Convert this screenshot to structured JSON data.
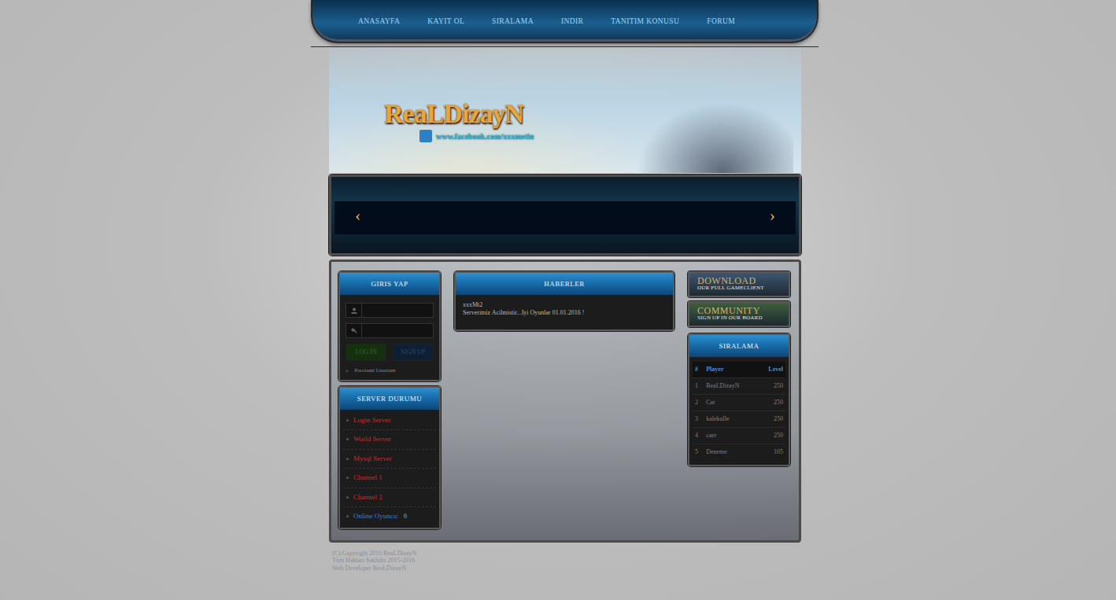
{
  "nav": [
    "ANASAYFA",
    "KAYIT OL",
    "SIRALAMA",
    "INDIR",
    "TANITIM KONUSU",
    "FORUM"
  ],
  "logo": {
    "title": "ReaLDizayN",
    "facebook": "www.facebook.com/xxxmetin"
  },
  "slider": {
    "prev": "‹",
    "next": "›"
  },
  "login": {
    "title": "GIRIS YAP",
    "buttons": [
      {
        "label": "LOG IN",
        "color": "#15300f"
      },
      {
        "label": "SIGN UP",
        "color": "#0d1f33"
      }
    ],
    "forgot_bullet": "»",
    "forgot": "Parolami Unuttum"
  },
  "server_status": {
    "title": "SERVER DURUMU",
    "items": [
      {
        "name": "Login Server",
        "online": false,
        "color": "#c4302b"
      },
      {
        "name": "World Server",
        "online": false,
        "color": "#c4302b"
      },
      {
        "name": "Mysql Server",
        "online": false,
        "color": "#c4302b"
      },
      {
        "name": "Channel 1",
        "online": false,
        "color": "#c4302b"
      },
      {
        "name": "Channel 2",
        "online": false,
        "color": "#c4302b"
      }
    ],
    "players": {
      "label": "Online Oyuncu:",
      "count": "0",
      "color": "#3d7fd0"
    }
  },
  "news": {
    "title": "HABERLER",
    "items": [
      {
        "title": "xxxMt2",
        "body": "Serverimiz Acilmistir...Iyi Oyunlar 01.01.2016 !"
      }
    ]
  },
  "promos": [
    {
      "title": "DOWNLOAD",
      "subtitle": "OUR FULL GAMECLIENT",
      "color": "#3d5670"
    },
    {
      "title": "COMMUNITY",
      "subtitle": "SIGN UP IN OUR BOARD",
      "color": "#3f5e3a"
    }
  ],
  "ranking": {
    "title": "SIRALAMA",
    "columns": [
      "#",
      "Player",
      "Level"
    ],
    "rows": [
      [
        "1",
        "ReaLDizayN",
        "250"
      ],
      [
        "2",
        "Car",
        "250"
      ],
      [
        "3",
        "kalekulle",
        "250"
      ],
      [
        "4",
        "caer",
        "250"
      ],
      [
        "5",
        "Deneme",
        "105"
      ]
    ]
  },
  "footer": [
    "(C) Copyright 2016 ReaLDizayN",
    "Tüm Hakları Saklıdır 2015-2016",
    "Web Developer ReaLDizayN"
  ]
}
